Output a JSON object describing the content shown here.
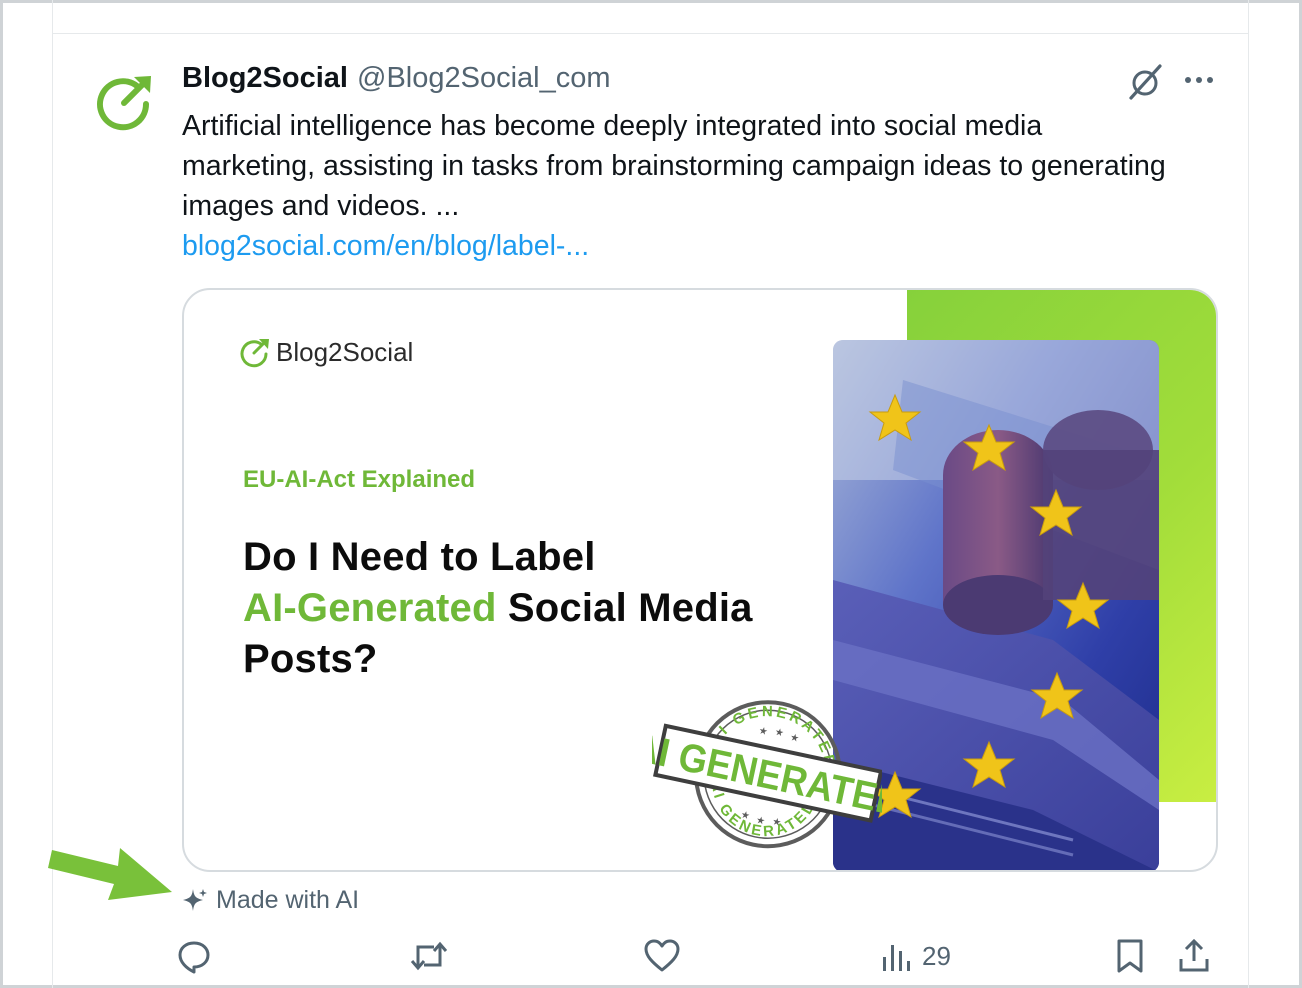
{
  "post": {
    "display_name": "Blog2Social",
    "handle": "@Blog2Social_com",
    "text": "Artificial intelligence has become deeply integrated into social media marketing, assisting in tasks from brainstorming campaign ideas to generating images and videos. ...",
    "link_text": "blog2social.com/en/blog/label-..."
  },
  "card": {
    "brand": "Blog2Social",
    "eyebrow": "EU-AI-Act Explained",
    "headline_part1": "Do I Need to Label",
    "headline_highlight": "AI-Generated",
    "headline_part2": "Social Media",
    "headline_part3": "Posts?",
    "stamp_main": "AI GENERATED",
    "stamp_ring": "AI GENERATED"
  },
  "ai_label": "Made with AI",
  "actions": {
    "views_count": "29"
  },
  "icons": {
    "avatar": "blog2social-logo-icon",
    "grok": "grok-icon",
    "more": "more-icon",
    "sparkle": "sparkle-icon",
    "reply": "reply-icon",
    "repost": "repost-icon",
    "like": "like-icon",
    "views": "views-icon",
    "bookmark": "bookmark-icon",
    "share": "share-icon"
  },
  "colors": {
    "brand_green": "#6fb838",
    "link_blue": "#1d9bf0",
    "secondary_text": "#536471",
    "arrow_green": "#79c13a"
  }
}
